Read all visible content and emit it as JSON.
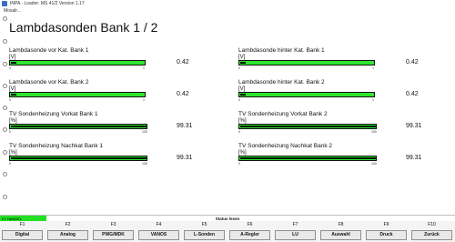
{
  "window": {
    "title": "INPA - Loader:  MS 41/2 Version 1.17"
  },
  "menu": {
    "items": [
      "Mosalr..."
    ]
  },
  "page_title": "Lambdasonden Bank 1 / 2",
  "gauges": [
    {
      "label": "Lambdasonde vor Kat. Bank 1",
      "unit": "[V]",
      "value": "0.42",
      "scale_min": "0",
      "scale_max": "1",
      "fraction": 0.42
    },
    {
      "label": "Lambdasonde hinter Kat. Bank 1",
      "unit": "[V]",
      "value": "0.42",
      "scale_min": "0",
      "scale_max": "1",
      "fraction": 0.42
    },
    {
      "label": "Lambdasonde vor Kat. Bank 2",
      "unit": "[V]",
      "value": "0.42",
      "scale_min": "0",
      "scale_max": "1",
      "fraction": 0.42
    },
    {
      "label": "Lambdasonde hinter Kat. Bank 2",
      "unit": "[V]",
      "value": "0.42",
      "scale_min": "0",
      "scale_max": "1",
      "fraction": 0.42
    },
    {
      "label": "TV Sondenheizung Vorkat Bank 1",
      "unit": "[%]",
      "value": "99.31",
      "scale_min": "0",
      "scale_max": "100",
      "fraction": 0.9931
    },
    {
      "label": "TV Sondenheizung Vorkat Bank 2",
      "unit": "[%]",
      "value": "99.31",
      "scale_min": "0",
      "scale_max": "100",
      "fraction": 0.9931
    },
    {
      "label": "TV Sondenheizung Nachkat Bank 1",
      "unit": "[%]",
      "value": "99.31",
      "scale_min": "0",
      "scale_max": "100",
      "fraction": 0.9931
    },
    {
      "label": "TV Sondenheizung Nachkat Bank 2",
      "unit": "[%]",
      "value": "99.31",
      "scale_min": "0",
      "scale_max": "100",
      "fraction": 0.9931
    }
  ],
  "status": {
    "left": "F1 HANDEL",
    "center": "Status lesen"
  },
  "fkeys": [
    {
      "key": "F1",
      "label": "Digital"
    },
    {
      "key": "F2",
      "label": "Analog"
    },
    {
      "key": "F3",
      "label": "PWG/MDK"
    },
    {
      "key": "F4",
      "label": "VANOS"
    },
    {
      "key": "F5",
      "label": "L-Sonden"
    },
    {
      "key": "F6",
      "label": "A-Regler"
    },
    {
      "key": "F7",
      "label": "LU"
    },
    {
      "key": "F8",
      "label": "Auswahl"
    },
    {
      "key": "F9",
      "label": "Druck"
    },
    {
      "key": "F10",
      "label": "Zurück"
    }
  ],
  "colors": {
    "bar_fill": "#2ee62e",
    "status_green": "#22e022"
  }
}
